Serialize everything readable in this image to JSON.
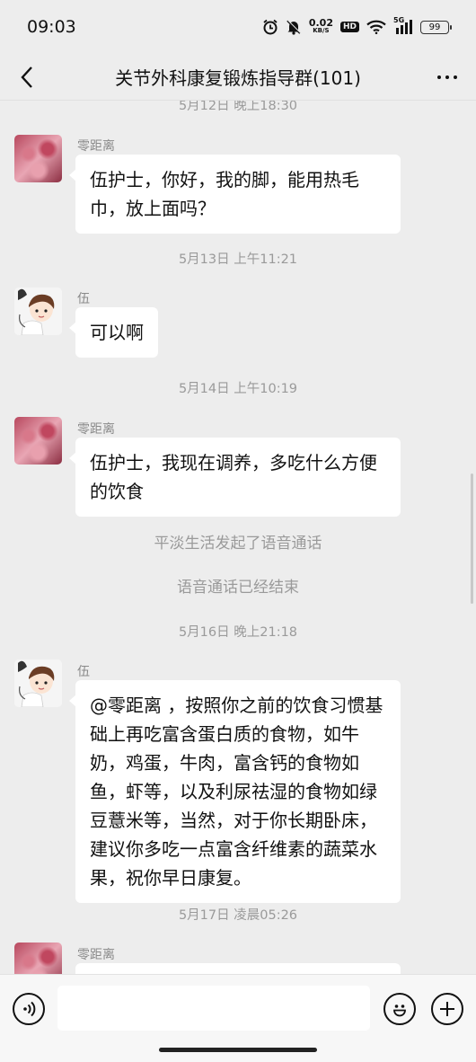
{
  "status_bar": {
    "time": "09:03",
    "net_speed": "0.02",
    "net_unit": "KB/S",
    "hd_badge": "HD",
    "signal_badge": "5G",
    "battery": "99"
  },
  "header": {
    "title": "关节外科康复锻炼指导群(101)"
  },
  "chat": {
    "items": [
      {
        "type": "timestamp",
        "text": "5月12日 晚上18:30"
      },
      {
        "type": "message",
        "sender": "零距离",
        "avatar": "cherry-blossom",
        "text": "伍护士，你好，我的脚，能用热毛巾，放上面吗？"
      },
      {
        "type": "timestamp",
        "text": "5月13日 上午11:21"
      },
      {
        "type": "message",
        "sender": "伍",
        "avatar": "cartoon-boy",
        "text": "可以啊"
      },
      {
        "type": "timestamp",
        "text": "5月14日 上午10:19"
      },
      {
        "type": "message",
        "sender": "零距离",
        "avatar": "cherry-blossom",
        "text": "伍护士，我现在调养，多吃什么方便的饮食"
      },
      {
        "type": "system",
        "text": "平淡生活发起了语音通话"
      },
      {
        "type": "system",
        "text": "语音通话已经结束"
      },
      {
        "type": "timestamp",
        "text": "5月16日 晚上21:18"
      },
      {
        "type": "message",
        "sender": "伍",
        "avatar": "cartoon-boy",
        "text": "@零距离 ，按照你之前的饮食习惯基础上再吃富含蛋白质的食物，如牛奶，鸡蛋，牛肉，富含钙的食物如鱼，虾等，以及利尿祛湿的食物如绿豆薏米等，当然，对于你长期卧床，建议你多吃一点富含纤维素的蔬菜水果，祝你早日康复。"
      },
      {
        "type": "timestamp",
        "text": "5月17日 凌晨05:26"
      },
      {
        "type": "message",
        "sender": "零距离",
        "avatar": "cherry-blossom",
        "text": ""
      }
    ]
  },
  "input_bar": {
    "voice_icon": "voice-icon",
    "emoji_icon": "emoji-icon",
    "plus_icon": "plus-icon",
    "text_value": ""
  }
}
